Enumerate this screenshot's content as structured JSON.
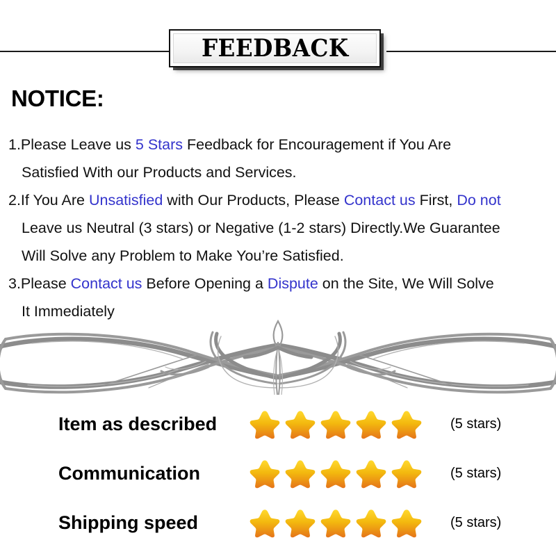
{
  "banner": {
    "title": "FEEDBACK"
  },
  "notice": {
    "heading": "NOTICE:",
    "items": [
      {
        "lines": [
          [
            {
              "t": "1.Please Leave us  ",
              "c": "black"
            },
            {
              "t": "5 Stars",
              "c": "blue"
            },
            {
              "t": "  Feedback for  Encouragement  if You Are",
              "c": "black"
            }
          ],
          [
            {
              "t": "Satisfied With our Products and Services.",
              "c": "black"
            }
          ]
        ]
      },
      {
        "lines": [
          [
            {
              "t": "2.If You Are ",
              "c": "black"
            },
            {
              "t": "Unsatisfied",
              "c": "blue"
            },
            {
              "t": " with Our Products, Please ",
              "c": "black"
            },
            {
              "t": "Contact us",
              "c": "blue"
            },
            {
              "t": " First, ",
              "c": "black"
            },
            {
              "t": "Do not",
              "c": "blue"
            }
          ],
          [
            {
              "t": "Leave us Neutral (3 stars) or Negative (1-2 stars) Directly.We Guarantee",
              "c": "black"
            }
          ],
          [
            {
              "t": "Will Solve any Problem to Make You’re  Satisfied.",
              "c": "black"
            }
          ]
        ]
      },
      {
        "lines": [
          [
            {
              "t": "3.Please ",
              "c": "black"
            },
            {
              "t": "Contact us",
              "c": "blue"
            },
            {
              "t": " Before Opening a ",
              "c": "black"
            },
            {
              "t": "Dispute",
              "c": "blue"
            },
            {
              "t": " on the Site, We Will Solve",
              "c": "black"
            }
          ],
          [
            {
              "t": "It Immediately",
              "c": "black"
            }
          ]
        ]
      }
    ]
  },
  "ratings": {
    "rows": [
      {
        "label": "Item as described",
        "stars": 5,
        "count_label": "(5 stars)"
      },
      {
        "label": "Communication",
        "stars": 5,
        "count_label": "(5 stars)"
      },
      {
        "label": "Shipping speed",
        "stars": 5,
        "count_label": "(5 stars)"
      }
    ]
  },
  "colors": {
    "accent_blue": "#3333CC",
    "star_top": "#FFD92E",
    "star_mid": "#F3B80E",
    "star_bottom": "#E5741A",
    "ornament_gray": "#8C8C8C",
    "text_black": "#111111"
  },
  "icons": {
    "star": "star-icon",
    "ornament": "filigree-ornament-icon"
  }
}
